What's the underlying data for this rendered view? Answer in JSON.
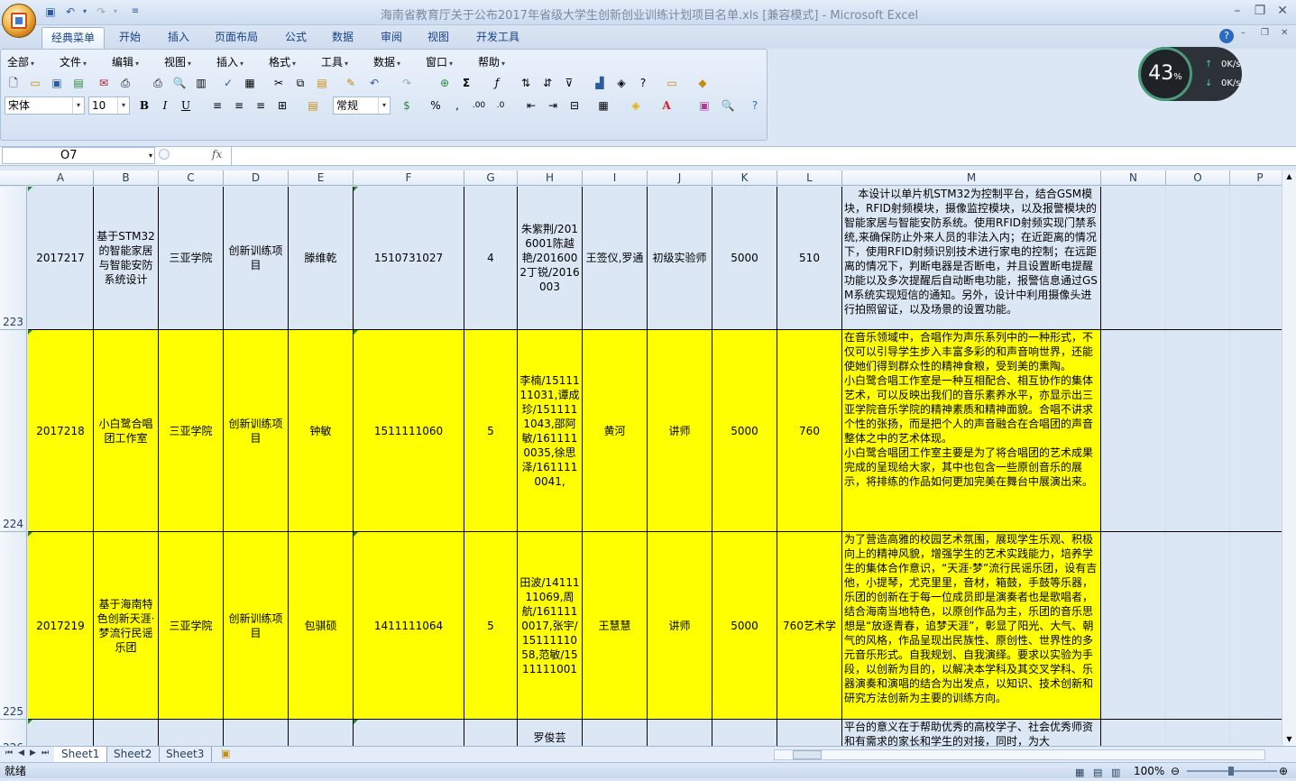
{
  "window": {
    "title": "海南省教育厅关于公布2017年省级大学生创新创业训练计划项目名单.xls  [兼容模式] - Microsoft Excel"
  },
  "ribbon_tabs": [
    "经典菜单",
    "开始",
    "插入",
    "页面布局",
    "公式",
    "数据",
    "审阅",
    "视图",
    "开发工具"
  ],
  "menu": [
    "全部",
    "文件",
    "编辑",
    "视图",
    "插入",
    "格式",
    "工具",
    "数据",
    "窗口",
    "帮助"
  ],
  "font": {
    "name": "宋体",
    "size": "10",
    "number_format": "常规"
  },
  "formula_bar": {
    "cell_ref": "O7",
    "fx": "fx",
    "value": ""
  },
  "columns": [
    "A",
    "B",
    "C",
    "D",
    "E",
    "F",
    "G",
    "H",
    "I",
    "J",
    "K",
    "L",
    "M",
    "N",
    "O",
    "P"
  ],
  "rows": [
    {
      "num": "223",
      "highlight": false,
      "cells": [
        "2017217",
        "基于STM32的智能家居与智能安防系统设计",
        "三亚学院",
        "创新训练项目",
        "滕维乾",
        "1510731027",
        "4",
        "朱紫荆/2016001陈越艳/2016002丁锐/2016003",
        "王签仪,罗通",
        "初级实验师",
        "5000",
        "510",
        "    本设计以单片机STM32为控制平台，结合GSM模块，RFID射频模块，摄像监控模块，以及报警模块的智能家居与智能安防系统。使用RFID射频实现门禁系统,来确保防止外来人员的非法入内；在近距离的情况下，使用RFID射频识别技术进行家电的控制；在远距离的情况下，判断电器是否断电，并且设置断电提醒功能以及多次提醒后自动断电功能，报警信息通过GSM系统实现短信的通知。另外，设计中利用摄像头进行拍照留证，以及场景的设置功能。"
      ]
    },
    {
      "num": "224",
      "highlight": true,
      "cells": [
        "2017218",
        "小白鹭合唱团工作室",
        "三亚学院",
        "创新训练项目",
        "钟敏",
        "1511111060",
        "5",
        "李楠/1511111031,谭成珍/1511111043,邵阿敏/1611110035,徐思泽/1611110041,",
        "黄河",
        "讲师",
        "5000",
        "760",
        "在音乐领域中，合唱作为声乐系列中的一种形式，不仅可以引导学生步入丰富多彩的和声音响世界，还能使她们得到群众性的精神食粮，受到美的熏陶。\n小白鹭合唱工作室是一种互相配合、相互协作的集体艺术，可以反映出我们的音乐素养水平，亦显示出三亚学院音乐学院的精神素质和精神面貌。合唱不讲求个性的张扬，而是把个人的声音融合在合唱团的声音整体之中的艺术体现。\n小白鹭合唱团工作室主要是为了将合唱团的艺术成果完成的呈现给大家，其中也包含一些原创音乐的展示，将排练的作品如何更加完美在舞台中展演出来。"
      ]
    },
    {
      "num": "225",
      "highlight": true,
      "cells": [
        "2017219",
        "基于海南特色创新天涯·梦流行民谣乐团",
        "三亚学院",
        "创新训练项目",
        "包骐硕",
        "1411111064",
        "5",
        "田波/1411111069,周航/1611110017,张宇/1511111058,范敏/1511111001",
        "王慧慧",
        "讲师",
        "5000",
        "760艺术学",
        "为了营造高雅的校园艺术氛围，展现学生乐观、积极向上的精神风貌，增强学生的艺术实践能力，培养学生的集体合作意识，“天涯·梦”流行民谣乐团，设有吉他，小提琴，尤克里里，音材，箱鼓，手鼓等乐器，乐团的创新在于每一位成员即是演奏者也是歌唱者，结合海南当地特色，以原创作品为主，乐团的音乐思想是“放逐青春，追梦天涯”，彰显了阳光、大气、朝气的风格，作品呈现出民族性、原创性、世界性的多元音乐形式。自我规划、自我演绎。要求以实验为手段，以创新为目的，以解决本学科及其交叉学科、乐器演奏和演唱的结合为出发点，以知识、技术创新和研究方法创新为主要的训练方向。"
      ]
    },
    {
      "num": "226",
      "highlight": false,
      "cells": [
        "",
        "",
        "",
        "",
        "",
        "",
        "",
        "罗俊芸",
        "",
        "",
        "",
        "",
        "平台的意义在于帮助优秀的高校学子、社会优秀师资和有需求的家长和学生的对接，同时，为大"
      ]
    }
  ],
  "sheet_tabs": [
    "Sheet1",
    "Sheet2",
    "Sheet3"
  ],
  "status": {
    "ready": "就绪",
    "zoom": "100%"
  },
  "net_widget": {
    "percent": "43",
    "unit": "%",
    "up": "0K/s",
    "down": "0K/s"
  },
  "colors": {
    "highlight": "#ffff00",
    "ribbon_text": "#15428b"
  }
}
